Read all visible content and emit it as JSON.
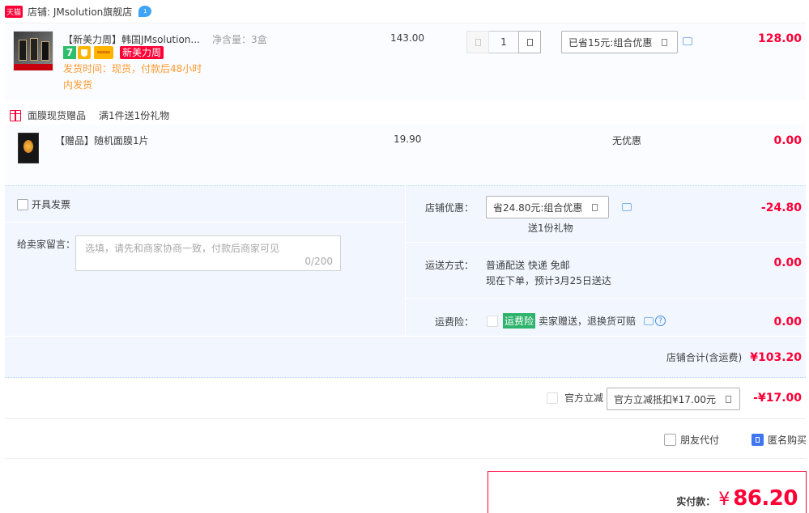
{
  "shop": {
    "badge": "天猫",
    "label": "店铺: JMsolution旗舰店",
    "wangwang_count": "1"
  },
  "item": {
    "title": "【新美力周】韩国JMsolution...",
    "spec": "净含量：3盒",
    "unit_price": "143.00",
    "quantity": "1",
    "promo_select": "已省15元:组合优惠",
    "subtotal": "128.00",
    "service_badge_7": "7",
    "tag": "新美力周",
    "shipping_time": "发货时间：现货，付款后48小时内发货"
  },
  "gift": {
    "header_name": "面膜现货赠品",
    "header_rule": "满1件送1份礼物",
    "title": "【赠品】随机面膜1片",
    "unit_price": "19.90",
    "discount": "无优惠",
    "subtotal": "0.00"
  },
  "invoice": {
    "label": "开具发票"
  },
  "message": {
    "label": "给卖家留言：",
    "placeholder": "选填，请先和商家协商一致，付款后商家可见",
    "counter": "0/200"
  },
  "store_discount": {
    "label": "店铺优惠：",
    "select": "省24.80元:组合优惠",
    "gift_note": "送1份礼物",
    "amount": "-24.80"
  },
  "delivery": {
    "label": "运送方式：",
    "method": "普通配送 快递 免邮",
    "eta": "现在下单，预计3月25日送达",
    "amount": "0.00"
  },
  "insurance": {
    "label": "运费险：",
    "badge": "运费险",
    "desc": "卖家赠送，退换货可赔",
    "amount": "0.00"
  },
  "store_total": {
    "label": "店铺合计(含运费)",
    "amount": "¥103.20"
  },
  "official": {
    "label": "官方立减",
    "select": "官方立减抵扣¥17.00元",
    "amount": "-¥17.00"
  },
  "options": {
    "friend_pay": "朋友代付",
    "anonymous": "匿名购买"
  },
  "payment": {
    "label": "实付款：",
    "currency": "¥",
    "amount": "86.20"
  },
  "colors": {
    "accent_red": "#ff0036",
    "panel_blue": "#f2f7ff",
    "border_blue": "#b2d1ff",
    "insurance_green": "#2db36b"
  }
}
